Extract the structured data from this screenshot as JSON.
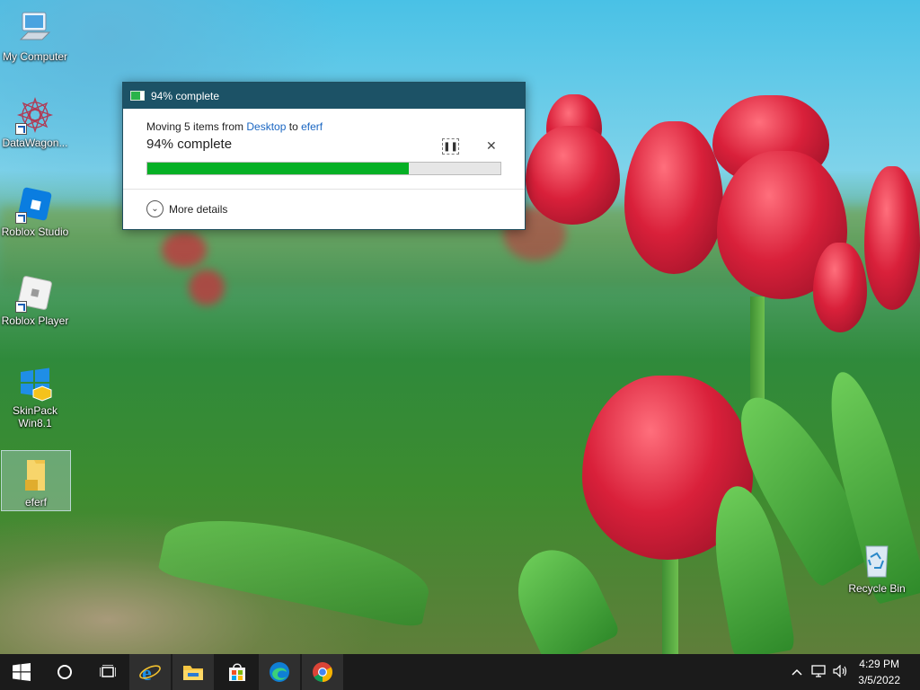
{
  "desktop": {
    "icons": [
      {
        "label": "My Computer",
        "icon": "computer-icon"
      },
      {
        "label": "DataWagon...",
        "icon": "datawagon-icon"
      },
      {
        "label": "Roblox Studio",
        "icon": "roblox-studio-icon"
      },
      {
        "label": "Roblox Player",
        "icon": "roblox-player-icon"
      },
      {
        "label": "SkinPack Win8.1",
        "icon": "windows-logo-icon"
      },
      {
        "label": "eferf",
        "icon": "folder-icon"
      }
    ],
    "recycle_bin": {
      "label": "Recycle Bin",
      "icon": "recycle-bin-icon"
    }
  },
  "dialog": {
    "title": "94% complete",
    "moving_prefix": "Moving 5 items from",
    "source": "Desktop",
    "to_word": "to",
    "destination": "eferf",
    "status": "94% complete",
    "progress_fraction": 0.74,
    "more_details": "More details",
    "colors": {
      "titlebar": "#1c5266",
      "progress": "#06b025",
      "link": "#1a66c2"
    }
  },
  "taskbar": {
    "buttons": [
      "start-icon",
      "search-icon",
      "task-view-icon"
    ],
    "apps": [
      "internet-explorer-icon",
      "file-explorer-icon",
      "store-icon",
      "edge-icon",
      "chrome-icon"
    ],
    "clock": {
      "time": "4:29 PM",
      "date": "3/5/2022"
    }
  }
}
